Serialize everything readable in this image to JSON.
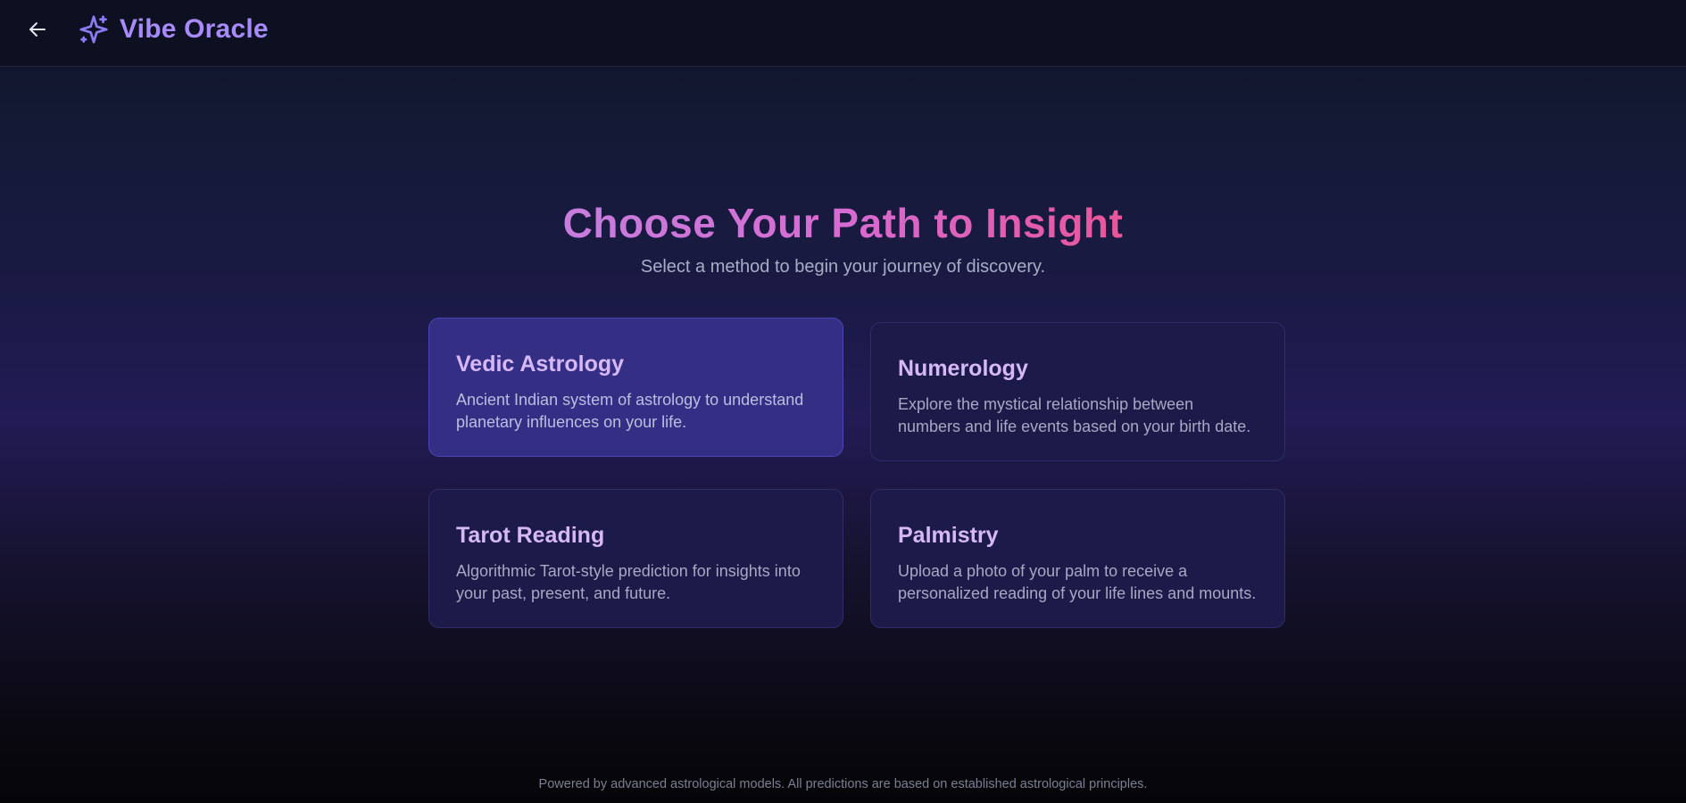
{
  "header": {
    "back_label": "Back",
    "app_name": "Vibe Oracle",
    "icons": {
      "back": "arrow-left-icon",
      "logo": "sparkle-icon"
    }
  },
  "hero": {
    "title": "Choose Your Path to Insight",
    "subtitle": "Select a method to begin your journey of discovery."
  },
  "cards": [
    {
      "title": "Vedic Astrology",
      "description": "Ancient Indian system of astrology to understand planetary influences on your life.",
      "state": "hovered"
    },
    {
      "title": "Numerology",
      "description": "Explore the mystical relationship between numbers and life events based on your birth date.",
      "state": "default"
    },
    {
      "title": "Tarot Reading",
      "description": "Algorithmic Tarot-style prediction for insights into your past, present, and future.",
      "state": "default"
    },
    {
      "title": "Palmistry",
      "description": "Upload a photo of your palm to receive a personalized reading of your life lines and mounts.",
      "state": "default"
    }
  ],
  "footer": {
    "text": "Powered by advanced astrological models. All predictions are based on established astrological principles."
  },
  "colors": {
    "brand": "#a78bfa",
    "title_gradient_start": "#c77dde",
    "title_gradient_end": "#e9559a",
    "card_background": "#1c1a48",
    "card_active_background": "#342f85",
    "card_title": "#d6b8f7"
  }
}
